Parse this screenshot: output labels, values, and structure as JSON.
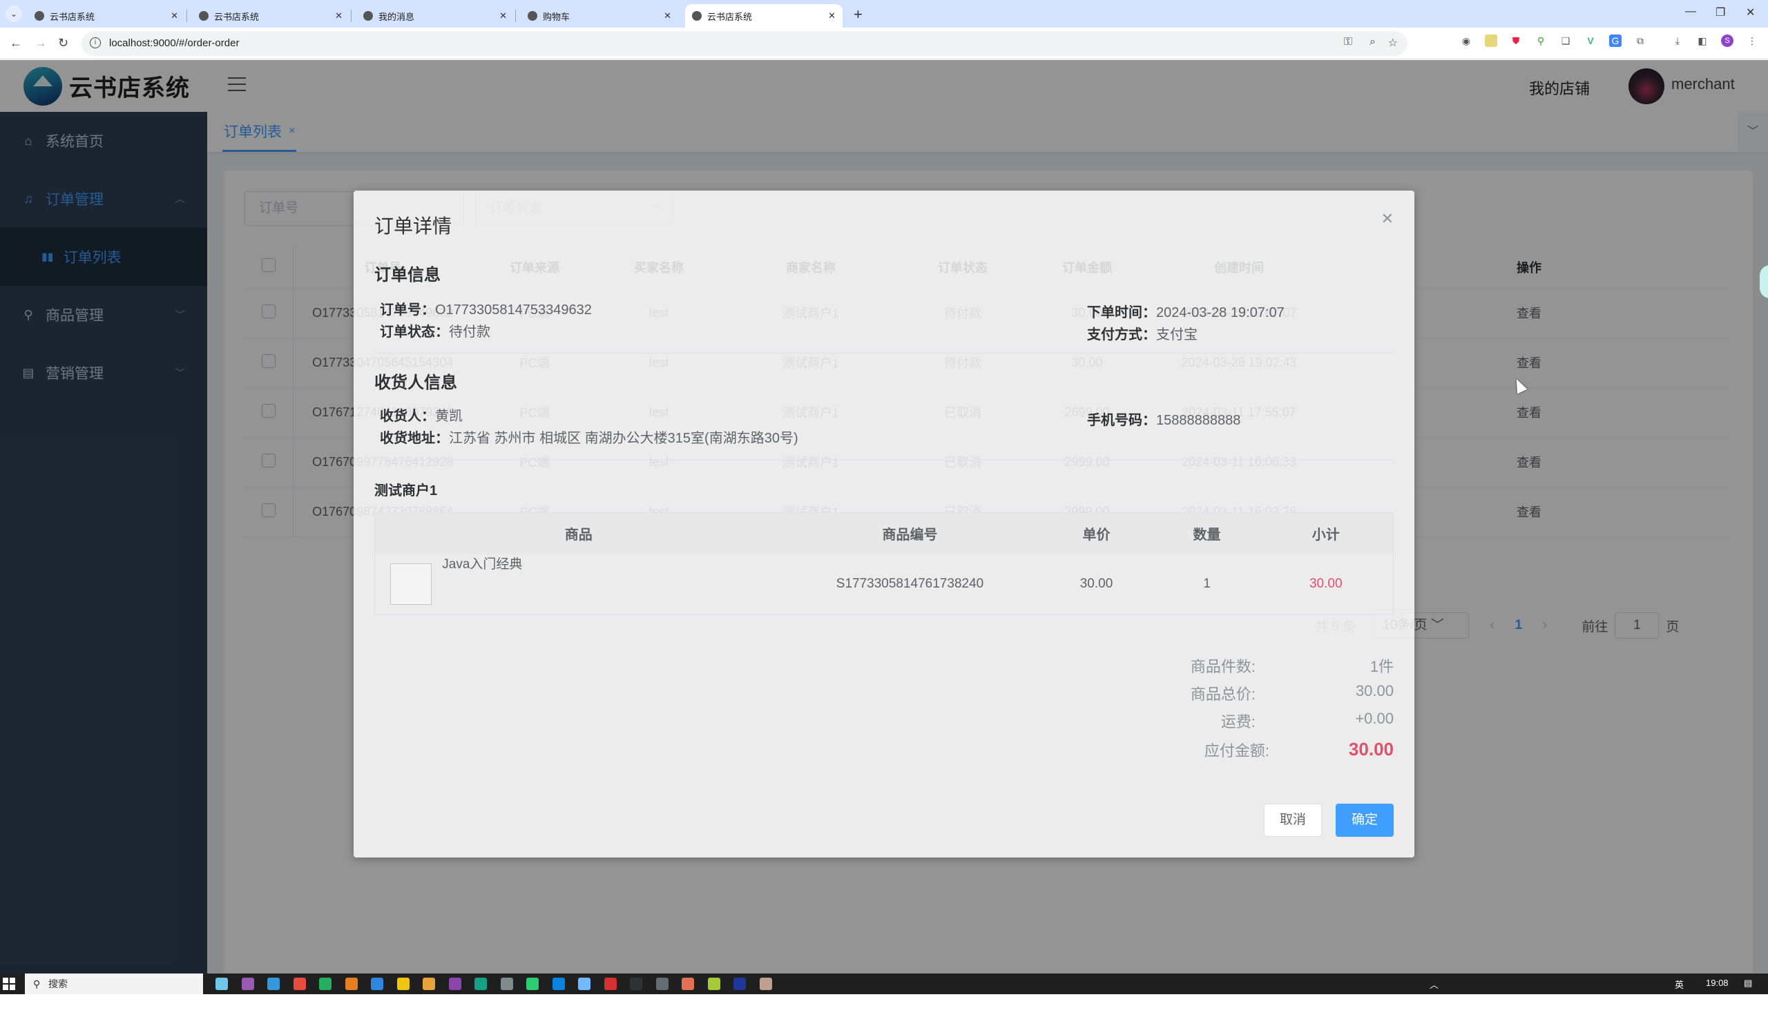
{
  "browser": {
    "tabs": [
      {
        "label": "云书店系统",
        "active": false
      },
      {
        "label": "云书店系统",
        "active": false
      },
      {
        "label": "我的消息",
        "active": false
      },
      {
        "label": "购物车",
        "active": false
      },
      {
        "label": "云书店系统",
        "active": true
      }
    ],
    "url": "localhost:9000/#/order-order",
    "profile_initial": "S"
  },
  "app": {
    "logo_text": "云书店系统",
    "header": {
      "shop_link": "我的店铺",
      "username": "merchant"
    },
    "sidebar": {
      "items": [
        {
          "label": "系统首页",
          "icon": "home-icon"
        },
        {
          "label": "订单管理",
          "icon": "bell-icon",
          "expanded": true
        },
        {
          "label": "订单列表",
          "icon": "bar-chart-icon",
          "active": true
        },
        {
          "label": "商品管理",
          "icon": "search-icon"
        },
        {
          "label": "营销管理",
          "icon": "document-icon"
        }
      ]
    },
    "tags": [
      {
        "label": "订单列表",
        "close": "×"
      }
    ],
    "filters": {
      "order_no_placeholder": "订单号",
      "status_placeholder": "订单状态"
    },
    "table": {
      "columns": [
        "订单号",
        "订单来源",
        "买家名称",
        "商家名称",
        "订单状态",
        "订单金额",
        "创建时间",
        "操作"
      ],
      "rows": [
        {
          "order_no": "O1773305814753349632",
          "source": "PC端",
          "buyer": "test",
          "merchant": "测试商户1",
          "status": "待付款",
          "amount": "30.00",
          "created": "2024-03-28 19:07:07",
          "action": "查看"
        },
        {
          "order_no": "O1773304705645154304",
          "source": "PC端",
          "buyer": "test",
          "merchant": "测试商户1",
          "status": "待付款",
          "amount": "30.00",
          "created": "2024-03-28 19:02:43",
          "action": "查看"
        },
        {
          "order_no": "O1767127404128979340",
          "source": "PC端",
          "buyer": "test",
          "merchant": "测试商户1",
          "status": "已取消",
          "amount": "2699.00",
          "created": "2024-03-11 17:55:07",
          "action": "查看"
        },
        {
          "order_no": "O1767099778476412928",
          "source": "PC端",
          "buyer": "test",
          "merchant": "测试商户1",
          "status": "已取消",
          "amount": "2999.00",
          "created": "2024-03-11 16:06:33",
          "action": "查看"
        },
        {
          "order_no": "O1767098742730788864",
          "source": "PC端",
          "buyer": "test",
          "merchant": "测试商户1",
          "status": "已取消",
          "amount": "3999.00",
          "created": "2024-03-11 16:02:26",
          "action": "查看"
        }
      ]
    },
    "pagination": {
      "total": "共 5 条",
      "page_size": "10条/页",
      "current_page": "1",
      "goto_label": "前往",
      "goto_value": "1",
      "page_suffix": "页",
      "prev": "‹",
      "next": "›"
    }
  },
  "dialog": {
    "title": "订单详情",
    "order_info": {
      "section_title": "订单信息",
      "order_no_label": "订单号：",
      "order_no": "O1773305814753349632",
      "status_label": "订单状态：",
      "status": "待付款",
      "time_label": "下单时间：",
      "time": "2024-03-28 19:07:07",
      "pay_label": "支付方式：",
      "pay": "支付宝"
    },
    "receiver_info": {
      "section_title": "收货人信息",
      "name_label": "收货人：",
      "name": "黄凯",
      "address_label": "收货地址：",
      "address": "江苏省 苏州市 相城区 南湖办公大楼315室(南湖东路30号)",
      "phone_label": "手机号码：",
      "phone": "15888888888"
    },
    "merchant_name": "测试商户1",
    "products": {
      "columns": [
        "商品",
        "商品编号",
        "单价",
        "数量",
        "小计"
      ],
      "rows": [
        {
          "name": "Java入门经典",
          "sku": "S1773305814761738240",
          "price": "30.00",
          "qty": "1",
          "subtotal": "30.00"
        }
      ]
    },
    "summary": [
      {
        "label": "商品件数:",
        "value": "1件"
      },
      {
        "label": "商品总价:",
        "value": "30.00"
      },
      {
        "label": "运费:",
        "value": "+0.00"
      },
      {
        "label": "应付金额:",
        "value": "30.00",
        "highlight": true
      }
    ],
    "cancel_label": "取消",
    "ok_label": "确定",
    "accent_color": "#409eff",
    "price_color": "#e0506a"
  },
  "taskbar": {
    "search_label": "搜索",
    "time": "19:08",
    "ime": "英"
  }
}
